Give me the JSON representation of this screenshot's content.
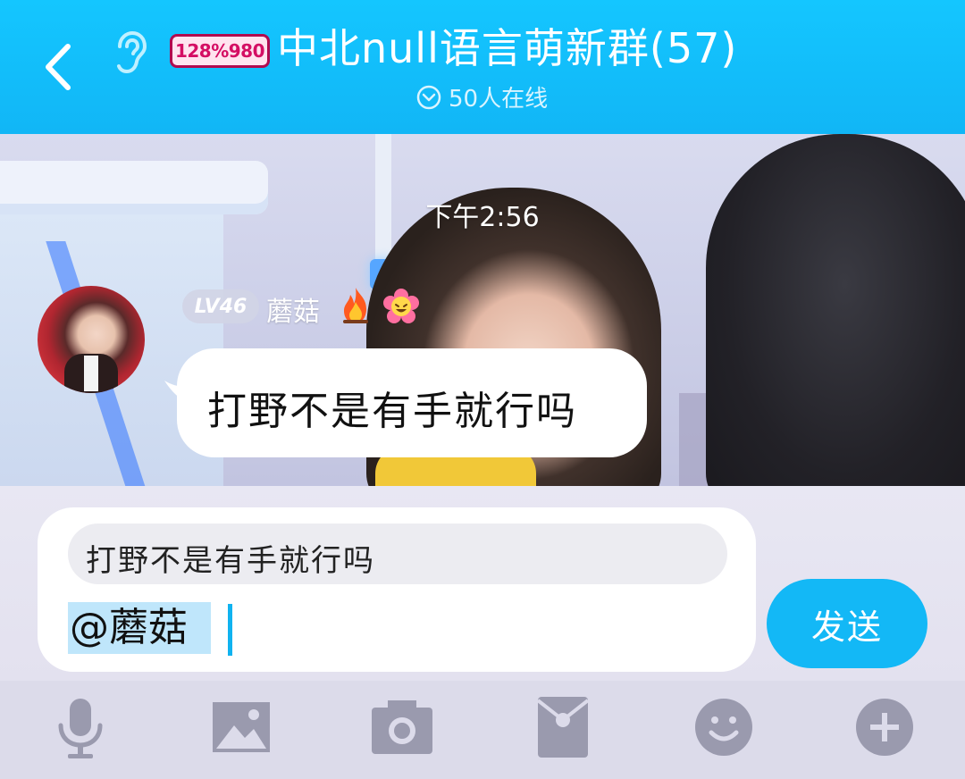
{
  "header": {
    "back_icon": "chevron-left-icon",
    "ear_icon": "ear-icon",
    "badge_text": "128%980",
    "title": "中北null语言萌新群(57)",
    "online_icon": "chevron-down-circle-icon",
    "online_text": "50人在线",
    "colors": {
      "bar": "#14c6ff",
      "badge_border": "#b10a4f",
      "badge_text": "#d40e64"
    }
  },
  "chat": {
    "timestamp": "下午2:56",
    "message": {
      "level": "LV46",
      "sender": "蘑菇",
      "badges": [
        "fire-icon",
        "flower-face-icon"
      ],
      "text": "打野不是有手就行吗"
    }
  },
  "input": {
    "quote_text": "打野不是有手就行吗",
    "mention": "@蘑菇",
    "send_label": "发送",
    "colors": {
      "accent": "#13b8f6",
      "mention_bg": "#bfe6fb"
    }
  },
  "toolbar": {
    "icons": [
      "microphone-icon",
      "image-icon",
      "camera-icon",
      "red-packet-icon",
      "emoji-icon",
      "plus-icon"
    ]
  }
}
